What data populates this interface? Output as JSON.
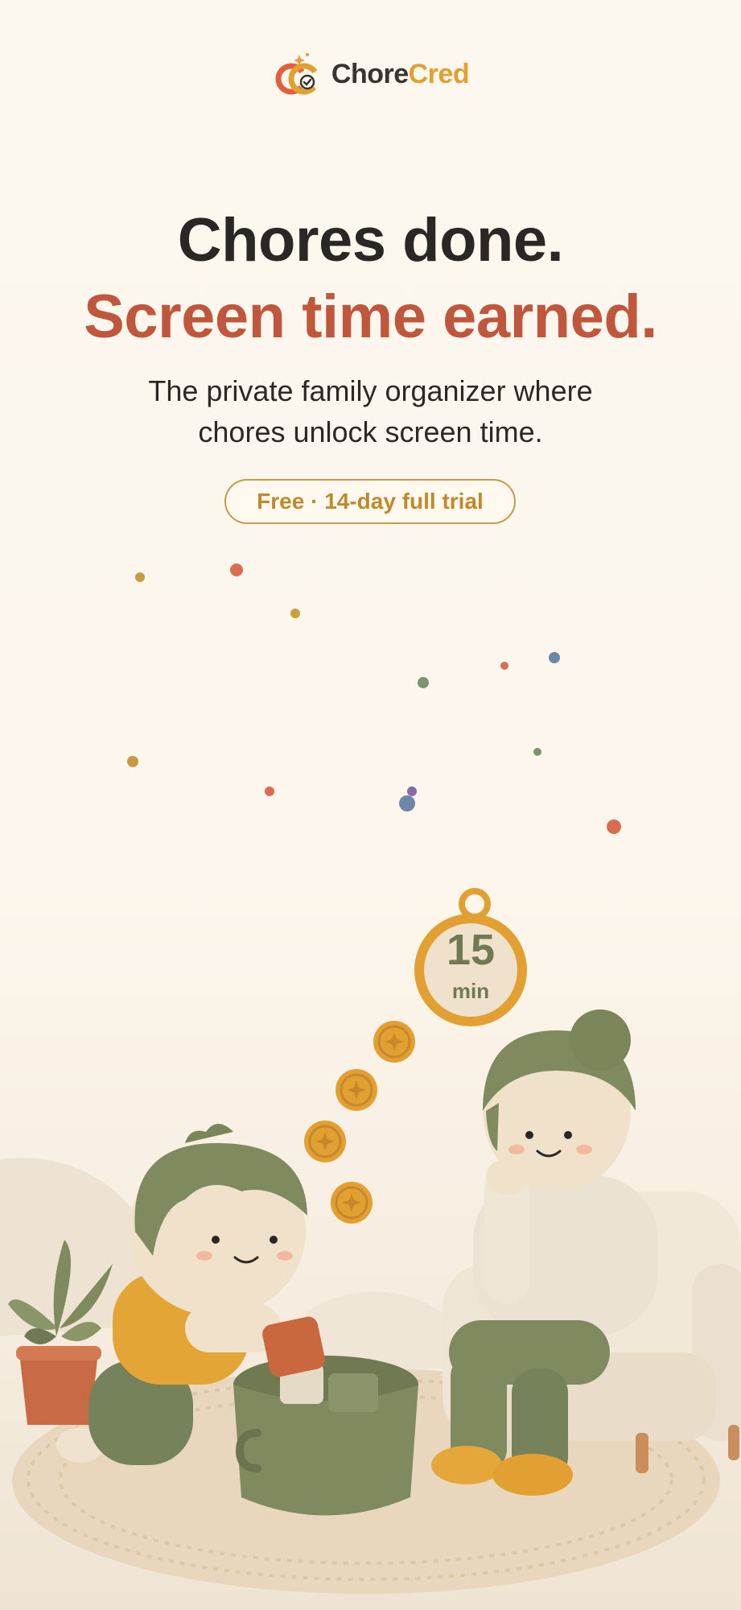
{
  "brand": {
    "name_part1": "Chore",
    "name_part2": "Cred",
    "logo_letters": "CC"
  },
  "hero": {
    "headline_line1": "Chores done.",
    "headline_line2": "Screen time earned.",
    "subtitle_line1": "The private family organizer where",
    "subtitle_line2": "chores unlock screen time.",
    "badge": "Free · 14-day full trial"
  },
  "illustration": {
    "timer_value": "15",
    "timer_unit": "min",
    "coin_icon": "sparkle-icon"
  },
  "colors": {
    "headline": "#2b2724",
    "accent": "#c0573c",
    "gold": "#e3a032",
    "olive": "#7f8b5f",
    "background": "#fcf6ec"
  }
}
